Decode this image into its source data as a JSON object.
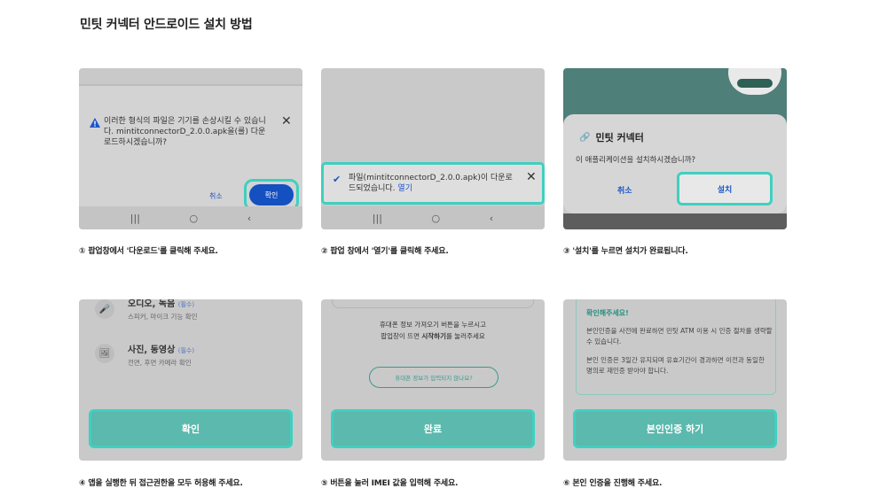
{
  "page": {
    "title": "민팃 커넥터 안드로이드 설치 방법"
  },
  "steps": [
    {
      "caption": "① 팝업창에서 '다운로드'를 클릭해 주세요.",
      "dialog": {
        "message": "이러한 형식의 파일은 기기를 손상시킬 수 있습니다. mintitconnectorD_2.0.0.apk을(를) 다운로드하시겠습니까?",
        "cancel": "취소",
        "confirm": "확인",
        "close": "✕"
      },
      "nav": [
        "|||",
        "○",
        "‹"
      ]
    },
    {
      "caption": "② 팝업 창에서 '열기'를 클릭해 주세요.",
      "notice": {
        "message": "파일(mintitconnectorD_2.0.0.apk)이 다운로드되었습니다.",
        "open": "열기",
        "close": "✕"
      },
      "nav": [
        "|||",
        "○",
        "‹"
      ]
    },
    {
      "caption": "③ '설치'를 누르면 설치가 완료됩니다.",
      "dialog": {
        "app_name": "민팃 커넥터",
        "question": "이 애플리케이션을 설치하시겠습니까?",
        "cancel": "취소",
        "install": "설치"
      }
    },
    {
      "caption": "④ 앱을 실행한 뒤 접근권한을 모두 허용해 주세요.",
      "permissions": [
        {
          "title": "오디오, 녹음",
          "required": "(필수)",
          "desc": "스피커, 마이크 기능 확인"
        },
        {
          "title": "사진, 동영상",
          "required": "(필수)",
          "desc": "전면, 후면 카메라 확인"
        }
      ],
      "button": "확인"
    },
    {
      "caption": "⑤ 버튼을 눌러 IMEI 값을 입력해 주세요.",
      "text_line1": "휴대폰 정보 가져오기 버튼을 누르시고",
      "text_line2_pre": "팝업창이 뜨면 ",
      "text_line2_bold": "시작하기",
      "text_line2_post": "를 눌러주세요",
      "pill": "휴대폰 정보가 입력되지 않나요?",
      "button": "완료"
    },
    {
      "caption": "⑥ 본인 인증을 진행해 주세요.",
      "heading": "확인해주세요!",
      "para1": "본인인증을 사전에 완료하면 민팃 ATM 이용 시 인증 절차를 생략할 수 있습니다.",
      "para2": "본인 인증은 3일간 유지되며 유효기간이 경과하면 이전과 동일한 명의로 재인증 받아야 합니다.",
      "button": "본인인증 하기"
    }
  ],
  "colors": {
    "highlight": "#3fd0c0",
    "primary_blue": "#1550c0",
    "mint_button": "#5bb9ad"
  }
}
